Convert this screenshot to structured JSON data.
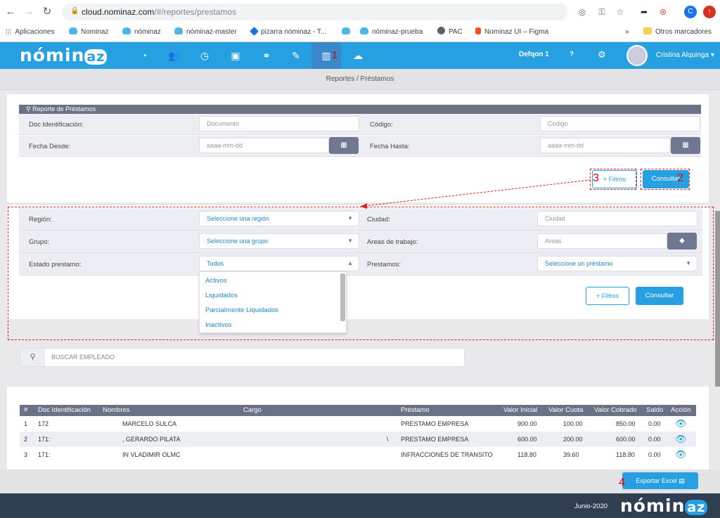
{
  "browser": {
    "url_host": "cloud.nominaz.com",
    "url_path": "/#/reportes/prestamos",
    "bookmarks": [
      {
        "label": "Aplicaciones",
        "icon": "apps-grid-icon"
      },
      {
        "label": "Nominaz",
        "icon": "cloud-icon"
      },
      {
        "label": "nóminaz",
        "icon": "cloud-icon"
      },
      {
        "label": "nóminaz-master",
        "icon": "cloud-icon"
      },
      {
        "label": "pizarra nóminaz - T...",
        "icon": "diamond-icon"
      },
      {
        "label": "",
        "icon": "cloud-icon"
      },
      {
        "label": "nóminaz-prueba",
        "icon": "cloud-icon"
      },
      {
        "label": "PAC",
        "icon": "globe-icon"
      },
      {
        "label": "Nominaz UI – Figma",
        "icon": "figma-icon"
      }
    ],
    "more_bookmarks": "»",
    "other_bookmarks": "Otros marcadores",
    "profile_initial": "C"
  },
  "app": {
    "logo_text": "nómin",
    "logo_badge": "az",
    "company": "Defqon 1",
    "help": "?",
    "user_name": "Cristina Alquinga ▾",
    "nav_icons": [
      "dashboard-icon",
      "users-icon",
      "clock-icon",
      "briefcase-icon",
      "handshake-icon",
      "edit-icon",
      "reports-chart-icon",
      "cloud-upload-icon"
    ]
  },
  "breadcrumb": "Reportes / Préstamos",
  "report": {
    "title": "Reporte de Préstamos",
    "doc_label": "Doc Identificación:",
    "doc_placeholder": "Documento",
    "code_label": "Código:",
    "code_placeholder": "Codigo",
    "from_label": "Fecha Desde:",
    "from_placeholder": "aaaa-mm-dd",
    "to_label": "Fecha Hasta:",
    "to_placeholder": "aaaa-mm-dd",
    "filters_btn": "+ Filtros",
    "query_btn": "Consultar"
  },
  "filters": {
    "region_label": "Región:",
    "region_value": "Seleccione una región",
    "city_label": "Ciudad:",
    "city_placeholder": "Ciudad",
    "group_label": "Grupo:",
    "group_value": "Seleccione una grupo",
    "areas_label": "Areas de trabajo:",
    "areas_placeholder": "Areas",
    "status_label": "Estado prestamo:",
    "status_value": "Todos",
    "loans_label": "Prestamos:",
    "loans_value": "Seleccione un préstamo",
    "status_options": [
      "Activos",
      "Liquidados",
      "Parcialmente Liquidados",
      "Inactivos"
    ],
    "filters_btn": "+ Filtros",
    "query_btn": "Consultar"
  },
  "search": {
    "placeholder": "BUSCAR EMPLEADO"
  },
  "table": {
    "headers": [
      "#",
      "Doc Identificación",
      "Nombres",
      "Cargo",
      "Préstamo",
      "Valor Inicial",
      "Valor Cuota",
      "Valor Cobrado",
      "Saldo",
      "Acción"
    ],
    "rows": [
      [
        "1",
        "172",
        "MARCELO SULCA",
        "",
        "PRESTAMO EMPRESA",
        "900.00",
        "100.00",
        "850.00",
        "0.00"
      ],
      [
        "2",
        "171:",
        ", GERARDO PILATA",
        "\\",
        "PRESTAMO EMPRESA",
        "600.00",
        "200.00",
        "600.00",
        "0.00"
      ],
      [
        "3",
        "171:",
        "IN VLADIMIR OLMC",
        "",
        "INFRACCIONES DE TRANSITO",
        "118.80",
        "39.60",
        "118.80",
        "0.00"
      ]
    ]
  },
  "export_btn": "Exportar Excel",
  "footer": {
    "copyright": "Junio-2020",
    "logo_text": "nómin",
    "logo_badge": "az"
  },
  "annotations": {
    "one": "1",
    "two": "2",
    "three": "3",
    "four": "4"
  },
  "colors": {
    "primary": "#26a0e0",
    "panel_header": "#6b7285",
    "annotation": "#e02020"
  }
}
